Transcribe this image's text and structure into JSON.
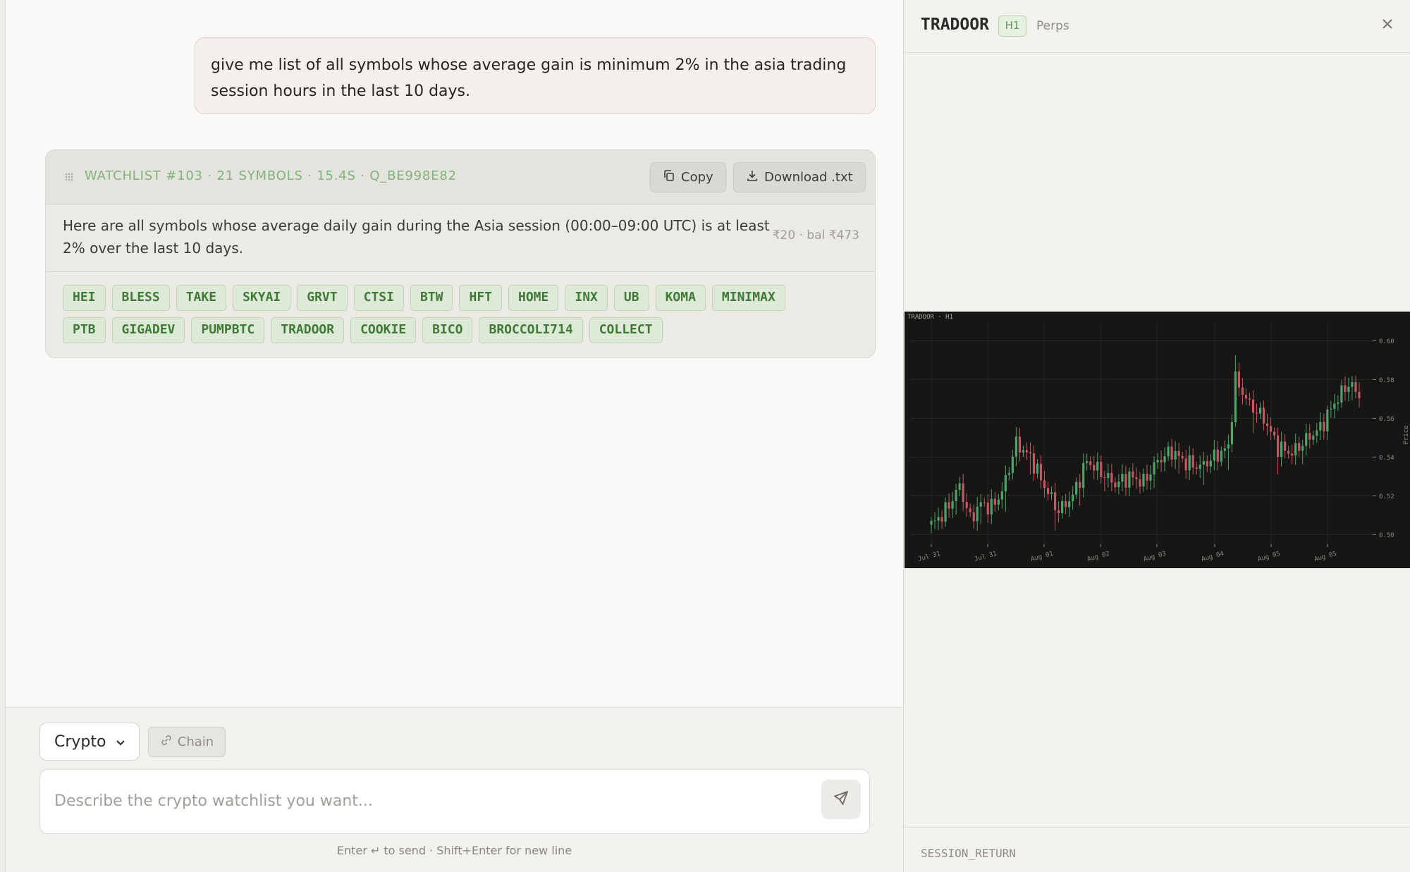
{
  "chat": {
    "user_message": "give me list of all symbols whose average gain is minimum 2% in the asia trading session hours in the last 10 days."
  },
  "watchlist": {
    "title": "WATCHLIST #103 · 21 SYMBOLS · 15.4S · Q_BE998E82",
    "copy_label": "Copy",
    "download_label": "Download .txt",
    "description": "Here are all symbols whose average daily gain during the Asia session (00:00–09:00 UTC) is at least 2% over the last 10 days.",
    "cost": "₹20 · bal ₹473",
    "symbols": [
      "HEI",
      "BLESS",
      "TAKE",
      "SKYAI",
      "GRVT",
      "CTSI",
      "BTW",
      "HFT",
      "HOME",
      "INX",
      "UB",
      "KOMA",
      "MINIMAX",
      "PTB",
      "GIGADEV",
      "PUMPBTC",
      "TRADOOR",
      "COOKIE",
      "BICO",
      "BROCCOLI714",
      "COLLECT"
    ]
  },
  "composer": {
    "market_value": "Crypto",
    "chain_label": "Chain",
    "placeholder": "Describe the crypto watchlist you want...",
    "hint": "Enter ↵ to send · Shift+Enter for new line"
  },
  "panel": {
    "symbol": "TRADOOR",
    "timeframe": "H1",
    "market": "Perps",
    "metric_label": "SESSION_RETURN"
  },
  "chart_data": {
    "type": "candlestick",
    "title": "TRADOOR · H1",
    "ylabel": "Price",
    "ylim": [
      0.495,
      0.61
    ],
    "y_ticks": [
      "0.60",
      "0.58",
      "0.56",
      "0.54",
      "0.52",
      "0.50"
    ],
    "x_ticks": [
      "Jul 31",
      "Jul 31",
      "Aug 01",
      "Aug 02",
      "Aug 03",
      "Aug 04",
      "Aug 05",
      "Aug 05"
    ],
    "up_color": "#4fa36a",
    "down_color": "#c25863",
    "close_anchors": [
      [
        0,
        0.505
      ],
      [
        4,
        0.512
      ],
      [
        8,
        0.525
      ],
      [
        11,
        0.508
      ],
      [
        14,
        0.516
      ],
      [
        17,
        0.514
      ],
      [
        20,
        0.522
      ],
      [
        24,
        0.547
      ],
      [
        28,
        0.54
      ],
      [
        32,
        0.525
      ],
      [
        36,
        0.512
      ],
      [
        40,
        0.52
      ],
      [
        44,
        0.538
      ],
      [
        48,
        0.532
      ],
      [
        52,
        0.526
      ],
      [
        56,
        0.53
      ],
      [
        60,
        0.527
      ],
      [
        64,
        0.538
      ],
      [
        68,
        0.543
      ],
      [
        72,
        0.537
      ],
      [
        76,
        0.535
      ],
      [
        80,
        0.54
      ],
      [
        84,
        0.545
      ],
      [
        86,
        0.58
      ],
      [
        90,
        0.567
      ],
      [
        94,
        0.56
      ],
      [
        98,
        0.545
      ],
      [
        102,
        0.542
      ],
      [
        106,
        0.549
      ],
      [
        110,
        0.555
      ],
      [
        114,
        0.568
      ],
      [
        118,
        0.578
      ],
      [
        121,
        0.572
      ]
    ]
  }
}
